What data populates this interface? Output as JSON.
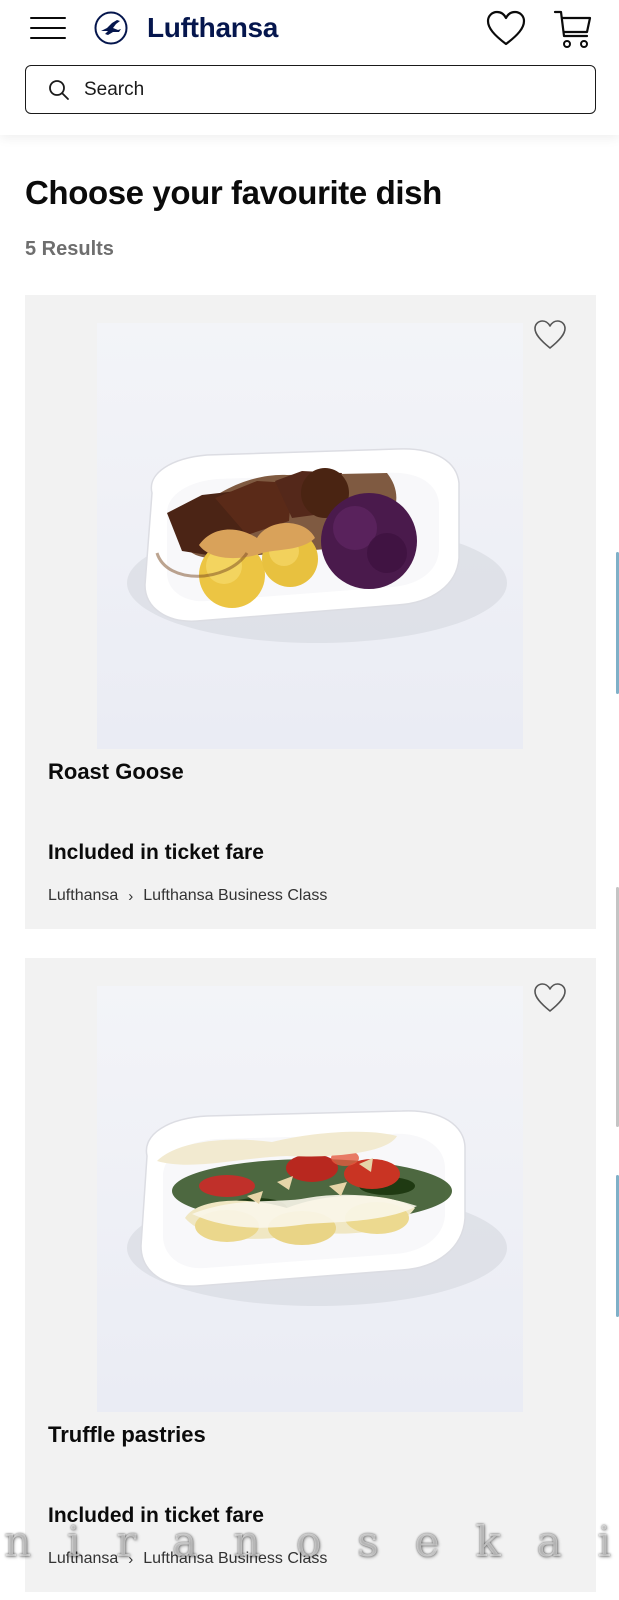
{
  "header": {
    "brand": "Lufthansa",
    "menu_icon": "hamburger-menu-icon",
    "logo_icon": "lufthansa-crane-logo",
    "wishlist_icon": "heart-icon",
    "cart_icon": "shopping-cart-icon"
  },
  "search": {
    "placeholder": "Search",
    "value": "",
    "icon": "search-icon"
  },
  "main": {
    "title": "Choose your favourite dish",
    "results_count": "5 Results"
  },
  "products": [
    {
      "name": "Roast Goose",
      "price": "Included in ticket fare",
      "breadcrumb": [
        "Lufthansa",
        "Lufthansa Business Class"
      ],
      "favourite_icon": "heart-outline-icon",
      "favourited": false
    },
    {
      "name": "Truffle pastries",
      "price": "Included in ticket fare",
      "breadcrumb": [
        "Lufthansa",
        "Lufthansa Business Class"
      ],
      "favourite_icon": "heart-outline-icon",
      "favourited": false
    }
  ],
  "watermark": {
    "letters": [
      "n",
      "i",
      "r",
      "a",
      "n",
      "o",
      "s",
      "e",
      "k",
      "a",
      "i"
    ]
  },
  "colors": {
    "brand_navy": "#05164d",
    "text": "#0b0b0b",
    "muted": "#6e6e6e",
    "card_bg": "#f2f2f2",
    "accent_edge": "#7fb0c8"
  }
}
